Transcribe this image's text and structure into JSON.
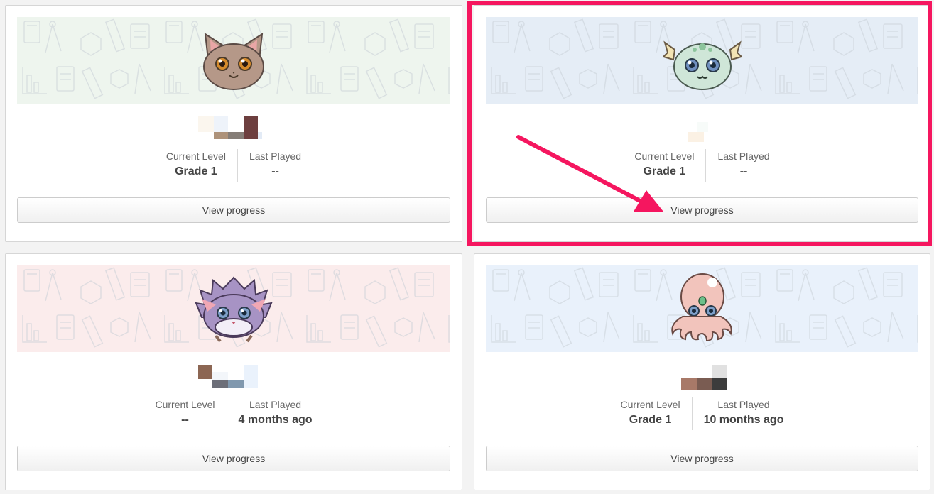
{
  "cards": [
    {
      "avatar": "cat-avatar",
      "banner_color": "#eef5ee",
      "current_level_label": "Current Level",
      "current_level": "Grade 1",
      "last_played_label": "Last Played",
      "last_played": "--",
      "button_label": "View progress"
    },
    {
      "avatar": "dragon-avatar",
      "banner_color": "#e5edf6",
      "current_level_label": "Current Level",
      "current_level": "Grade 1",
      "last_played_label": "Last Played",
      "last_played": "--",
      "button_label": "View progress"
    },
    {
      "avatar": "hedgehog-avatar",
      "banner_color": "#fbecec",
      "current_level_label": "Current Level",
      "current_level": "--",
      "last_played_label": "Last Played",
      "last_played": "4 months ago",
      "button_label": "View progress"
    },
    {
      "avatar": "octopus-avatar",
      "banner_color": "#e9f1fb",
      "current_level_label": "Current Level",
      "current_level": "Grade 1",
      "last_played_label": "Last Played",
      "last_played": "10 months ago",
      "button_label": "View progress"
    }
  ],
  "highlight_color": "#f5165f"
}
